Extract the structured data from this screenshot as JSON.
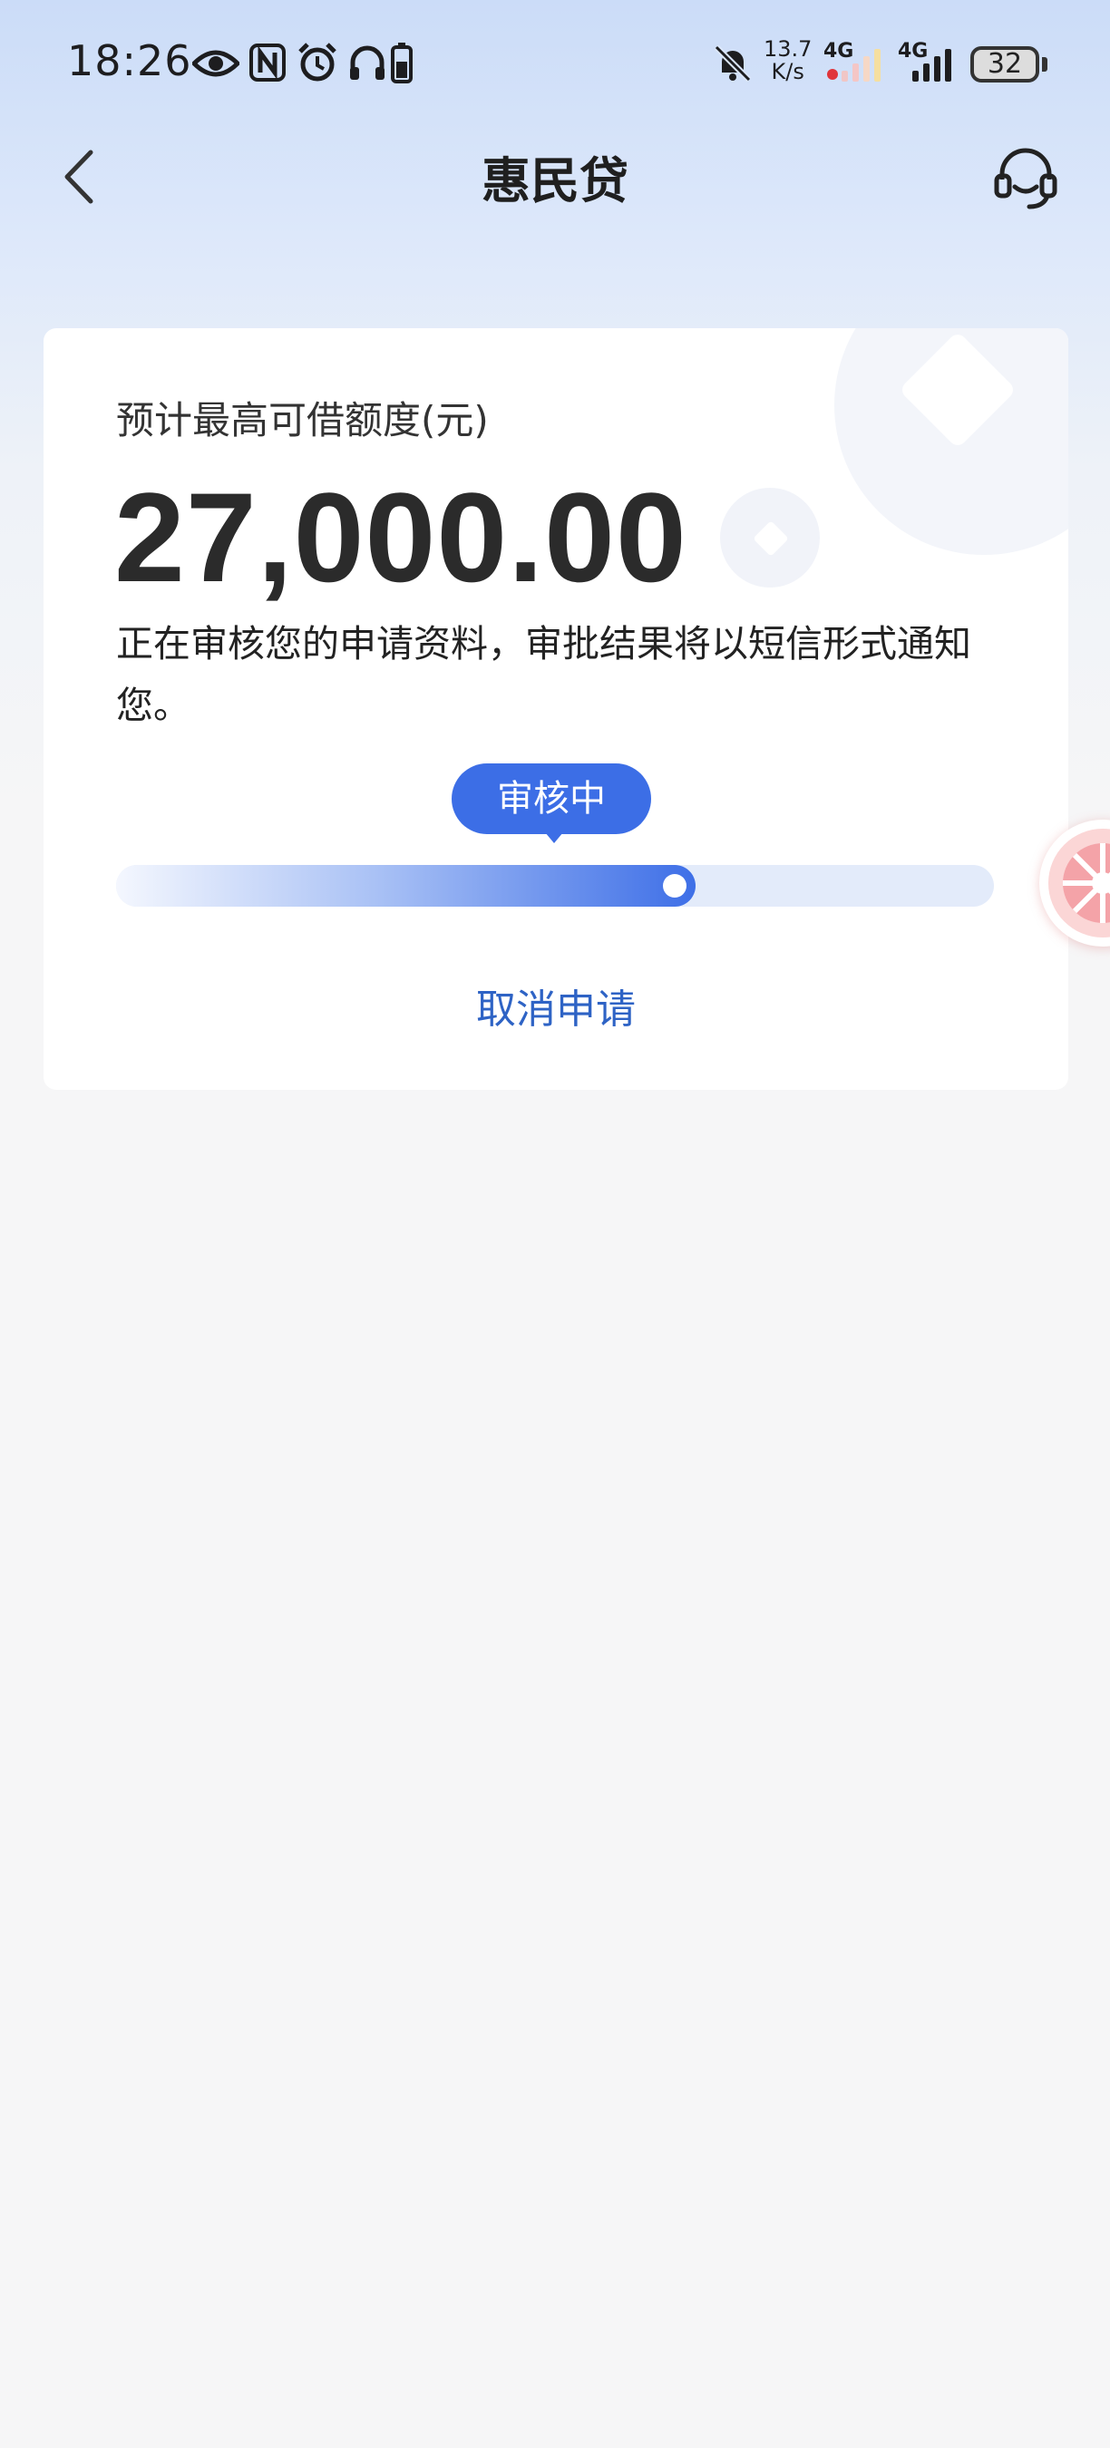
{
  "status_bar": {
    "time": "18:26",
    "net_speed_value": "13.7",
    "net_speed_unit": "K/s",
    "network_1": "4G",
    "network_2": "4G",
    "battery": "32",
    "icons": [
      "eye-icon",
      "nfc-icon",
      "alarm-icon",
      "headphones-icon",
      "phone-battery-icon",
      "mute-bell-icon",
      "signal-icon",
      "signal-icon"
    ]
  },
  "nav": {
    "title": "惠民贷",
    "back_icon": "chevron-left-icon",
    "service_icon": "customer-service-icon"
  },
  "card": {
    "limit_label": "预计最高可借额度(元)",
    "limit_amount": "27,000.00",
    "review_text": "正在审核您的申请资料，审批结果将以短信形式通知您。",
    "status_badge": "审核中",
    "progress_fraction": 0.66,
    "cancel_label": "取消申请"
  },
  "colors": {
    "accent": "#3c6ee6",
    "link": "#2e63c5",
    "background": "#f6f6f7",
    "header_gradient": "#cbdcf8"
  }
}
